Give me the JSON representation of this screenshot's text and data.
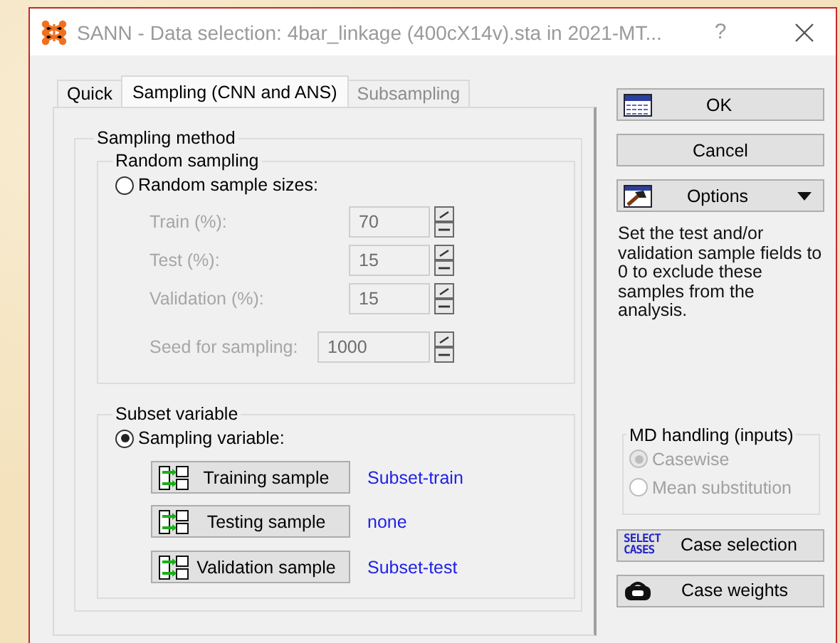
{
  "window": {
    "title": "SANN - Data selection: 4bar_linkage (400cX14v).sta in 2021-MT...",
    "help": "?"
  },
  "tabs": [
    {
      "label": "Quick",
      "selected": false,
      "disabled": false
    },
    {
      "label": "Sampling (CNN and ANS)",
      "selected": true,
      "disabled": false
    },
    {
      "label": "Subsampling",
      "selected": false,
      "disabled": true
    }
  ],
  "sampling_method": {
    "title": "Sampling method",
    "random_sampling": {
      "title": "Random sampling",
      "option": {
        "label": "Random sample sizes:",
        "selected": false
      },
      "fields": [
        {
          "label": "Train (%):",
          "value": "70",
          "kind": "percent",
          "disabled": true
        },
        {
          "label": "Test (%):",
          "value": "15",
          "kind": "percent",
          "disabled": true
        },
        {
          "label": "Validation (%):",
          "value": "15",
          "kind": "percent",
          "disabled": true
        },
        {
          "label": "Seed for sampling:",
          "value": "1000",
          "kind": "seed",
          "disabled": true
        }
      ]
    },
    "subset_variable": {
      "title": "Subset variable",
      "option": {
        "label": "Sampling variable:",
        "selected": true
      },
      "samples": [
        {
          "button": "Training sample",
          "variable": "Subset-train"
        },
        {
          "button": "Testing sample",
          "variable": "none"
        },
        {
          "button": "Validation sample",
          "variable": "Subset-test"
        }
      ]
    }
  },
  "buttons": [
    {
      "label": "OK",
      "kind": "ok"
    },
    {
      "label": "Cancel",
      "kind": "plain"
    },
    {
      "label": "Options",
      "kind": "menu"
    }
  ],
  "hint": "Set the test and/or validation sample fields to 0 to exclude these samples from the analysis.",
  "md_handling": {
    "title": "MD handling (inputs)",
    "disabled": true,
    "options": [
      {
        "label": "Casewise",
        "selected": true
      },
      {
        "label": "Mean substitution",
        "selected": false
      }
    ]
  },
  "case_buttons": [
    {
      "label": "Case selection",
      "kind": "select",
      "icon_text": [
        "SELECT",
        "CASES"
      ]
    },
    {
      "label": "Case weights",
      "kind": "weights"
    }
  ]
}
